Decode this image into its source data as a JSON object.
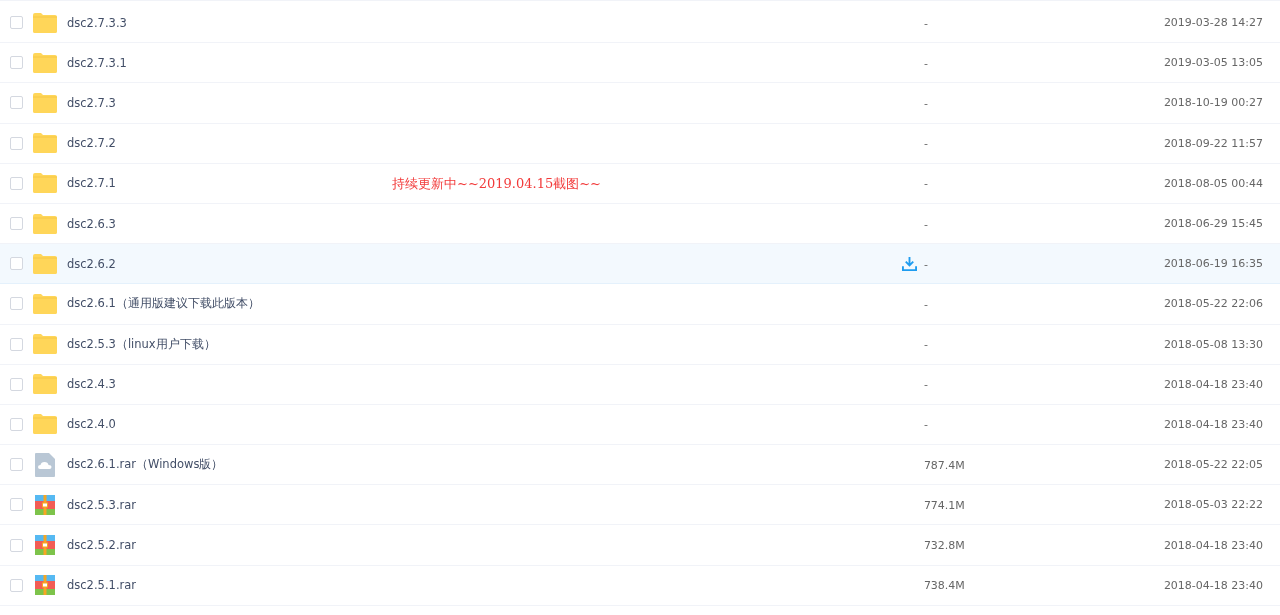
{
  "files": [
    {
      "kind": "folder",
      "name": "dsc2.7.3.3",
      "size": "-",
      "modified": "2019-03-28 14:27",
      "checked": false,
      "hovered": false
    },
    {
      "kind": "folder",
      "name": "dsc2.7.3.1",
      "size": "-",
      "modified": "2019-03-05 13:05",
      "checked": false,
      "hovered": false
    },
    {
      "kind": "folder",
      "name": "dsc2.7.3",
      "size": "-",
      "modified": "2018-10-19 00:27",
      "checked": false,
      "hovered": false
    },
    {
      "kind": "folder",
      "name": "dsc2.7.2",
      "size": "-",
      "modified": "2018-09-22 11:57",
      "checked": false,
      "hovered": false
    },
    {
      "kind": "folder",
      "name": "dsc2.7.1",
      "size": "-",
      "modified": "2018-08-05 00:44",
      "checked": false,
      "hovered": false
    },
    {
      "kind": "folder",
      "name": "dsc2.6.3",
      "size": "-",
      "modified": "2018-06-29 15:45",
      "checked": false,
      "hovered": false
    },
    {
      "kind": "folder",
      "name": "dsc2.6.2",
      "size": "-",
      "modified": "2018-06-19 16:35",
      "checked": false,
      "hovered": true
    },
    {
      "kind": "folder",
      "name": "dsc2.6.1（通用版建议下载此版本）",
      "size": "-",
      "modified": "2018-05-22 22:06",
      "checked": false,
      "hovered": false
    },
    {
      "kind": "folder",
      "name": "dsc2.5.3（linux用户下载）",
      "size": "-",
      "modified": "2018-05-08 13:30",
      "checked": false,
      "hovered": false
    },
    {
      "kind": "folder",
      "name": "dsc2.4.3",
      "size": "-",
      "modified": "2018-04-18 23:40",
      "checked": false,
      "hovered": false
    },
    {
      "kind": "folder",
      "name": "dsc2.4.0",
      "size": "-",
      "modified": "2018-04-18 23:40",
      "checked": false,
      "hovered": false
    },
    {
      "kind": "cloud",
      "name": "dsc2.6.1.rar（Windows版）",
      "size": "787.4M",
      "modified": "2018-05-22 22:05",
      "checked": false,
      "hovered": false
    },
    {
      "kind": "archive",
      "name": "dsc2.5.3.rar",
      "size": "774.1M",
      "modified": "2018-05-03 22:22",
      "checked": false,
      "hovered": false
    },
    {
      "kind": "archive",
      "name": "dsc2.5.2.rar",
      "size": "732.8M",
      "modified": "2018-04-18 23:40",
      "checked": false,
      "hovered": false
    },
    {
      "kind": "archive",
      "name": "dsc2.5.1.rar",
      "size": "738.4M",
      "modified": "2018-04-18 23:40",
      "checked": false,
      "hovered": false
    }
  ],
  "annotation": {
    "text": "持续更新中~~2019.04.15截图~~"
  }
}
